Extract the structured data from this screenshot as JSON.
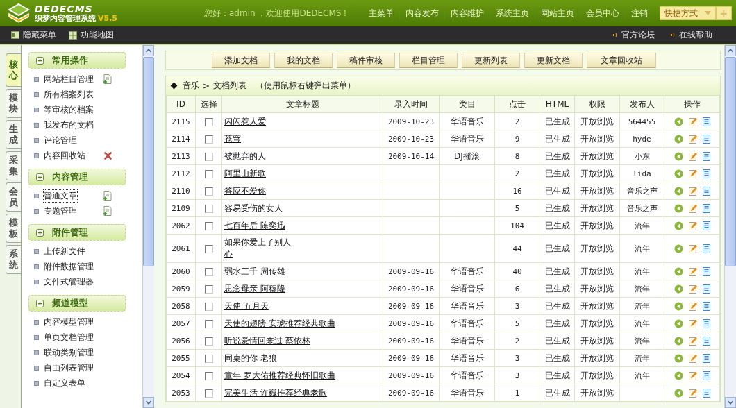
{
  "header": {
    "logo": {
      "name": "DEDECMS",
      "subtitle": "织梦内容管理系统",
      "version": "V5.5"
    },
    "greeting": "您好：admin ，欢迎使用DEDECMS！",
    "nav": [
      "主菜单",
      "内容发布",
      "内容维护",
      "系统主页",
      "网站主页",
      "会员中心",
      "注销"
    ],
    "shortcut": {
      "label": "快捷方式",
      "add": "+"
    }
  },
  "toolbar": {
    "left": [
      {
        "label": "隐藏菜单",
        "kind": "hide"
      },
      {
        "label": "功能地图",
        "kind": "map"
      }
    ],
    "right": [
      "官方论坛",
      "在线帮助"
    ]
  },
  "side_tabs": [
    {
      "label": "核心",
      "selected": true
    },
    {
      "label": "模块",
      "selected": false
    },
    {
      "label": "生成",
      "selected": false
    },
    {
      "label": "采集",
      "selected": false
    },
    {
      "label": "会员",
      "selected": false
    },
    {
      "label": "模板",
      "selected": false
    },
    {
      "label": "系统",
      "selected": false
    }
  ],
  "menu_groups": [
    {
      "title": "常用操作",
      "items": [
        {
          "label": "网站栏目管理",
          "kind": "add",
          "focused": false
        },
        {
          "label": "所有档案列表",
          "kind": "plain",
          "focused": false
        },
        {
          "label": "等审核的档案",
          "kind": "plain",
          "focused": false
        },
        {
          "label": "我发布的文档",
          "kind": "plain",
          "focused": false
        },
        {
          "label": "评论管理",
          "kind": "plain",
          "focused": false
        },
        {
          "label": "内容回收站",
          "kind": "delete",
          "focused": false
        }
      ]
    },
    {
      "title": "内容管理",
      "items": [
        {
          "label": "普通文章",
          "kind": "add",
          "focused": true
        },
        {
          "label": "专题管理",
          "kind": "add",
          "focused": false
        }
      ]
    },
    {
      "title": "附件管理",
      "items": [
        {
          "label": "上传新文件",
          "focused": false
        },
        {
          "label": "附件数据管理",
          "focused": false
        },
        {
          "label": "文件式管理器",
          "focused": false
        }
      ]
    },
    {
      "title": "频道模型",
      "items": [
        {
          "label": "内容模型管理",
          "focused": false
        },
        {
          "label": "单页文档管理",
          "focused": false
        },
        {
          "label": "联动类别管理",
          "focused": false
        },
        {
          "label": "自由列表管理",
          "focused": false
        },
        {
          "label": "自定义表单",
          "focused": false
        }
      ]
    }
  ],
  "buttons": [
    "添加文档",
    "我的文档",
    "稿件审核",
    "栏目管理",
    "更新列表",
    "更新文档",
    "文章回收站"
  ],
  "breadcrumb": {
    "category": "音乐",
    "separator": ">",
    "page": "文档列表",
    "hint": "（使用鼠标右键弹出菜单）"
  },
  "table": {
    "columns": [
      "ID",
      "选择",
      "文章标题",
      "录入时间",
      "类目",
      "点击",
      "HTML",
      "权限",
      "发布人",
      "操作"
    ],
    "rows": [
      {
        "id": "2115",
        "checked": false,
        "title": "闪闪惹人爱",
        "date": "2009-10-23",
        "category": "华语音乐",
        "clicks": "2",
        "html": "已生成",
        "access": "开放浏览",
        "author": "564455"
      },
      {
        "id": "2114",
        "checked": false,
        "title": "苍穹",
        "date": "2009-10-23",
        "category": "华语音乐",
        "clicks": "9",
        "html": "已生成",
        "access": "开放浏览",
        "author": "hyde"
      },
      {
        "id": "2113",
        "checked": false,
        "title": "被抛弃的人",
        "date": "2009-10-14",
        "category": "DJ摇滚",
        "clicks": "8",
        "html": "已生成",
        "access": "开放浏览",
        "author": "小东"
      },
      {
        "id": "2112",
        "checked": false,
        "title": "阿里山新歌",
        "clicks": "2",
        "html": "已生成",
        "access": "开放浏览",
        "author": "lida"
      },
      {
        "id": "2110",
        "checked": false,
        "title": "答应不爱你",
        "clicks": "16",
        "html": "已生成",
        "access": "开放浏览",
        "author": "音乐之声"
      },
      {
        "id": "2109",
        "checked": false,
        "title": "容易受伤的女人",
        "clicks": "5",
        "html": "已生成",
        "access": "开放浏览",
        "author": "音乐之声"
      },
      {
        "id": "2062",
        "checked": false,
        "title": "七百年后 陈奕迅",
        "clicks": "104",
        "html": "已生成",
        "access": "开放浏览",
        "author": "流年"
      },
      {
        "id": "2061",
        "checked": false,
        "title": "如果你爱上了别人",
        "title_2": "心",
        "clicks": "44",
        "html": "已生成",
        "access": "开放浏览",
        "author": "流年"
      },
      {
        "id": "2060",
        "checked": false,
        "title": "弱水三千 周传雄",
        "date": "2009-09-16",
        "category": "华语音乐",
        "clicks": "40",
        "html": "已生成",
        "access": "开放浏览",
        "author": "流年"
      },
      {
        "id": "2059",
        "checked": false,
        "title": "思念母亲 阿穆隆",
        "date": "2009-09-16",
        "category": "华语音乐",
        "clicks": "6",
        "html": "已生成",
        "access": "开放浏览",
        "author": "流年"
      },
      {
        "id": "2058",
        "checked": false,
        "title": "天使 五月天",
        "date": "2009-09-16",
        "category": "华语音乐",
        "clicks": "3",
        "html": "已生成",
        "access": "开放浏览",
        "author": "流年"
      },
      {
        "id": "2057",
        "checked": false,
        "title": "天使的翅膀 安琥推荐经典歌曲",
        "date": "2009-09-16",
        "category": "华语音乐",
        "clicks": "5",
        "html": "已生成",
        "access": "开放浏览",
        "author": "流年"
      },
      {
        "id": "2056",
        "checked": false,
        "title": "听说爱情回来过 蔡依林",
        "date": "2009-09-16",
        "category": "华语音乐",
        "clicks": "2",
        "html": "已生成",
        "access": "开放浏览",
        "author": "流年"
      },
      {
        "id": "2055",
        "checked": false,
        "title": "同桌的你 老狼",
        "date": "2009-09-16",
        "category": "华语音乐",
        "clicks": "3",
        "html": "已生成",
        "access": "开放浏览",
        "author": "流年"
      },
      {
        "id": "2054",
        "checked": false,
        "title": "童年 罗大佑推荐经典怀旧歌曲",
        "date": "2009-09-16",
        "category": "华语音乐",
        "clicks": "3",
        "html": "已生成",
        "access": "开放浏览",
        "author": "流年"
      },
      {
        "id": "2053",
        "checked": false,
        "title": "完美生活 许巍推荐经典老歌",
        "date": "2009-09-16",
        "category": "华语音乐",
        "clicks": "1",
        "html": "已生成",
        "access": "开放浏览"
      }
    ]
  }
}
